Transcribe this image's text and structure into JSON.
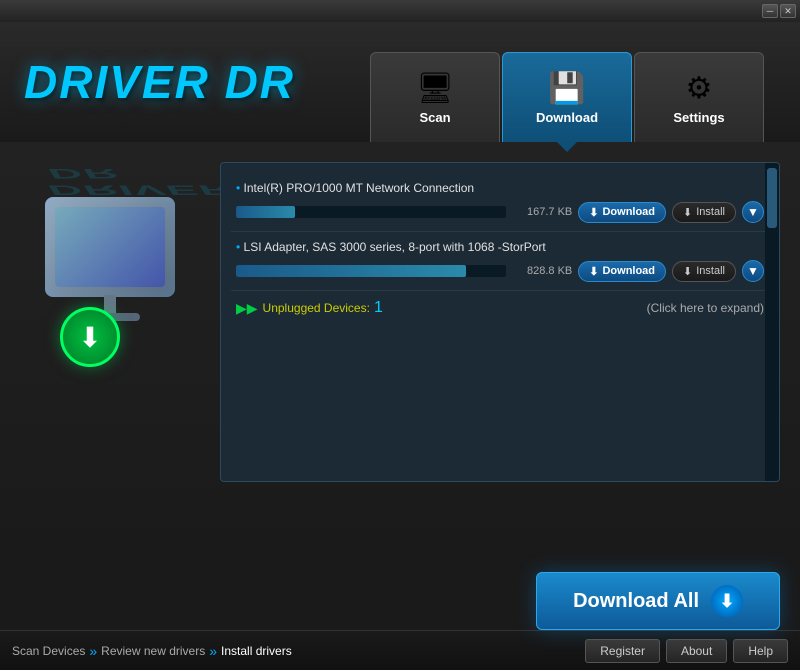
{
  "titlebar": {
    "minimize_label": "─",
    "close_label": "✕"
  },
  "logo": {
    "text": "DRIVER DR"
  },
  "tabs": [
    {
      "id": "scan",
      "label": "Scan",
      "icon": "🔍",
      "active": false
    },
    {
      "id": "download",
      "label": "Download",
      "icon": "💾",
      "active": true
    },
    {
      "id": "settings",
      "label": "Settings",
      "icon": "⚙",
      "active": false
    }
  ],
  "drivers": [
    {
      "name": "Intel(R) PRO/1000 MT Network Connection",
      "size": "167.7 KB",
      "size_pct": 22,
      "download_label": "Download",
      "install_label": "Install"
    },
    {
      "name": "LSI Adapter, SAS 3000 series, 8-port with 1068 -StorPort",
      "size": "828.8 KB",
      "size_pct": 85,
      "download_label": "Download",
      "install_label": "Install"
    }
  ],
  "unplugged": {
    "label": "Unplugged Devices:",
    "count": "1",
    "expand_hint": "(Click here to expand)"
  },
  "download_all": {
    "label": "Download All"
  },
  "footer": {
    "breadcrumb": [
      {
        "label": "Scan Devices",
        "active": false
      },
      {
        "label": "Review new drivers",
        "active": false
      },
      {
        "label": "Install drivers",
        "active": true
      }
    ],
    "buttons": [
      {
        "id": "register",
        "label": "Register"
      },
      {
        "id": "about",
        "label": "About"
      },
      {
        "id": "help",
        "label": "Help"
      }
    ]
  }
}
